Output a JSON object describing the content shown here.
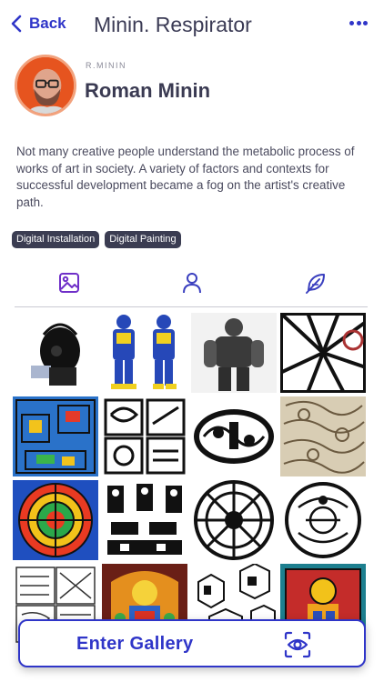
{
  "nav": {
    "back_label": "Back",
    "title": "Minin. Respirator",
    "menu_icon": "more-dots-icon"
  },
  "profile": {
    "handle": "R.MININ",
    "name": "Roman Minin"
  },
  "bio": "Not many creative people understand the metabolic process of works of art in society. A variety of factors and contexts for successful development became a fog on the artist's creative path.",
  "tags": [
    "Digital Installation",
    "Digital Painting"
  ],
  "tabs": [
    {
      "icon": "image-icon"
    },
    {
      "icon": "person-icon"
    },
    {
      "icon": "feather-icon"
    }
  ],
  "gallery_tiles": [
    "black respirator sculpture",
    "blue and yellow figure statues",
    "dark grey robot sculpture",
    "black and white rays graphic",
    "blue stained glass panel",
    "black and white ornament grid",
    "black and white oval ornament",
    "sepia ornament painting",
    "colorful mandala",
    "black and white ornamental figures",
    "black and white circular mandala",
    "black and white round ornament",
    "black and white line pattern",
    "colorful icon painting",
    "isometric sculptures",
    "colorful figure painting"
  ],
  "accent_color": "#2f35c8",
  "enter_button": {
    "label": "Enter Gallery",
    "icon": "eye-scan-icon"
  }
}
